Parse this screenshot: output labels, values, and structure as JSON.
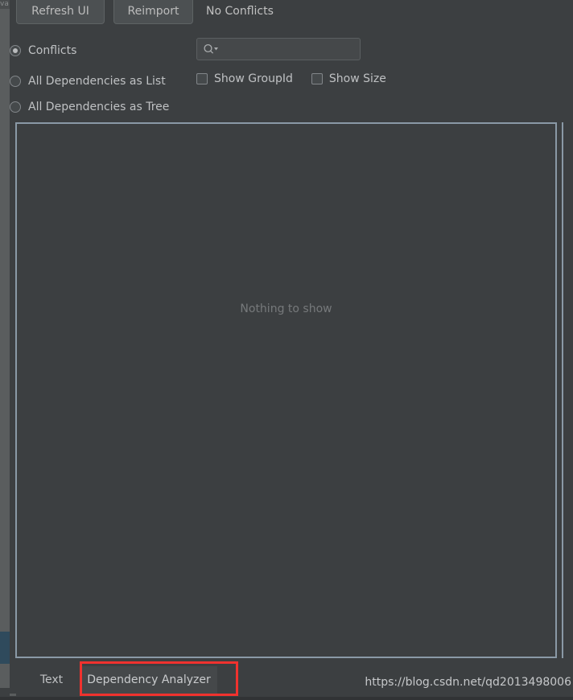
{
  "window": {
    "gutter_fragment": "va"
  },
  "toolbar": {
    "refresh_label": "Refresh UI",
    "reimport_label": "Reimport",
    "status_label": "No Conflicts"
  },
  "view_options": {
    "radios": [
      {
        "label": "Conflicts",
        "selected": true
      },
      {
        "label": "All Dependencies as List",
        "selected": false
      },
      {
        "label": "All Dependencies as Tree",
        "selected": false
      }
    ],
    "checkboxes": [
      {
        "label": "Show GroupId",
        "checked": false
      },
      {
        "label": "Show Size",
        "checked": false
      }
    ]
  },
  "search": {
    "value": "",
    "placeholder": "",
    "icon": "search-icon",
    "dropdown_icon": "chevron-down-icon"
  },
  "content": {
    "empty_message": "Nothing to show"
  },
  "tabs": [
    {
      "label": "Text",
      "active": false
    },
    {
      "label": "Dependency Analyzer",
      "active": true
    }
  ],
  "annotation": {
    "color": "#f0322e",
    "target": "Dependency Analyzer"
  },
  "watermark": {
    "text": "https://blog.csdn.net/qd2013498006"
  },
  "colors": {
    "background": "#3c3f41",
    "panel_border": "#8a99a6",
    "button_face": "#4c5052",
    "text": "#bfc1c3",
    "muted_text": "#76797b",
    "gutter": "#5a5d5e",
    "gutter_thumb": "#2f4a5c",
    "annotation": "#f0322e"
  }
}
